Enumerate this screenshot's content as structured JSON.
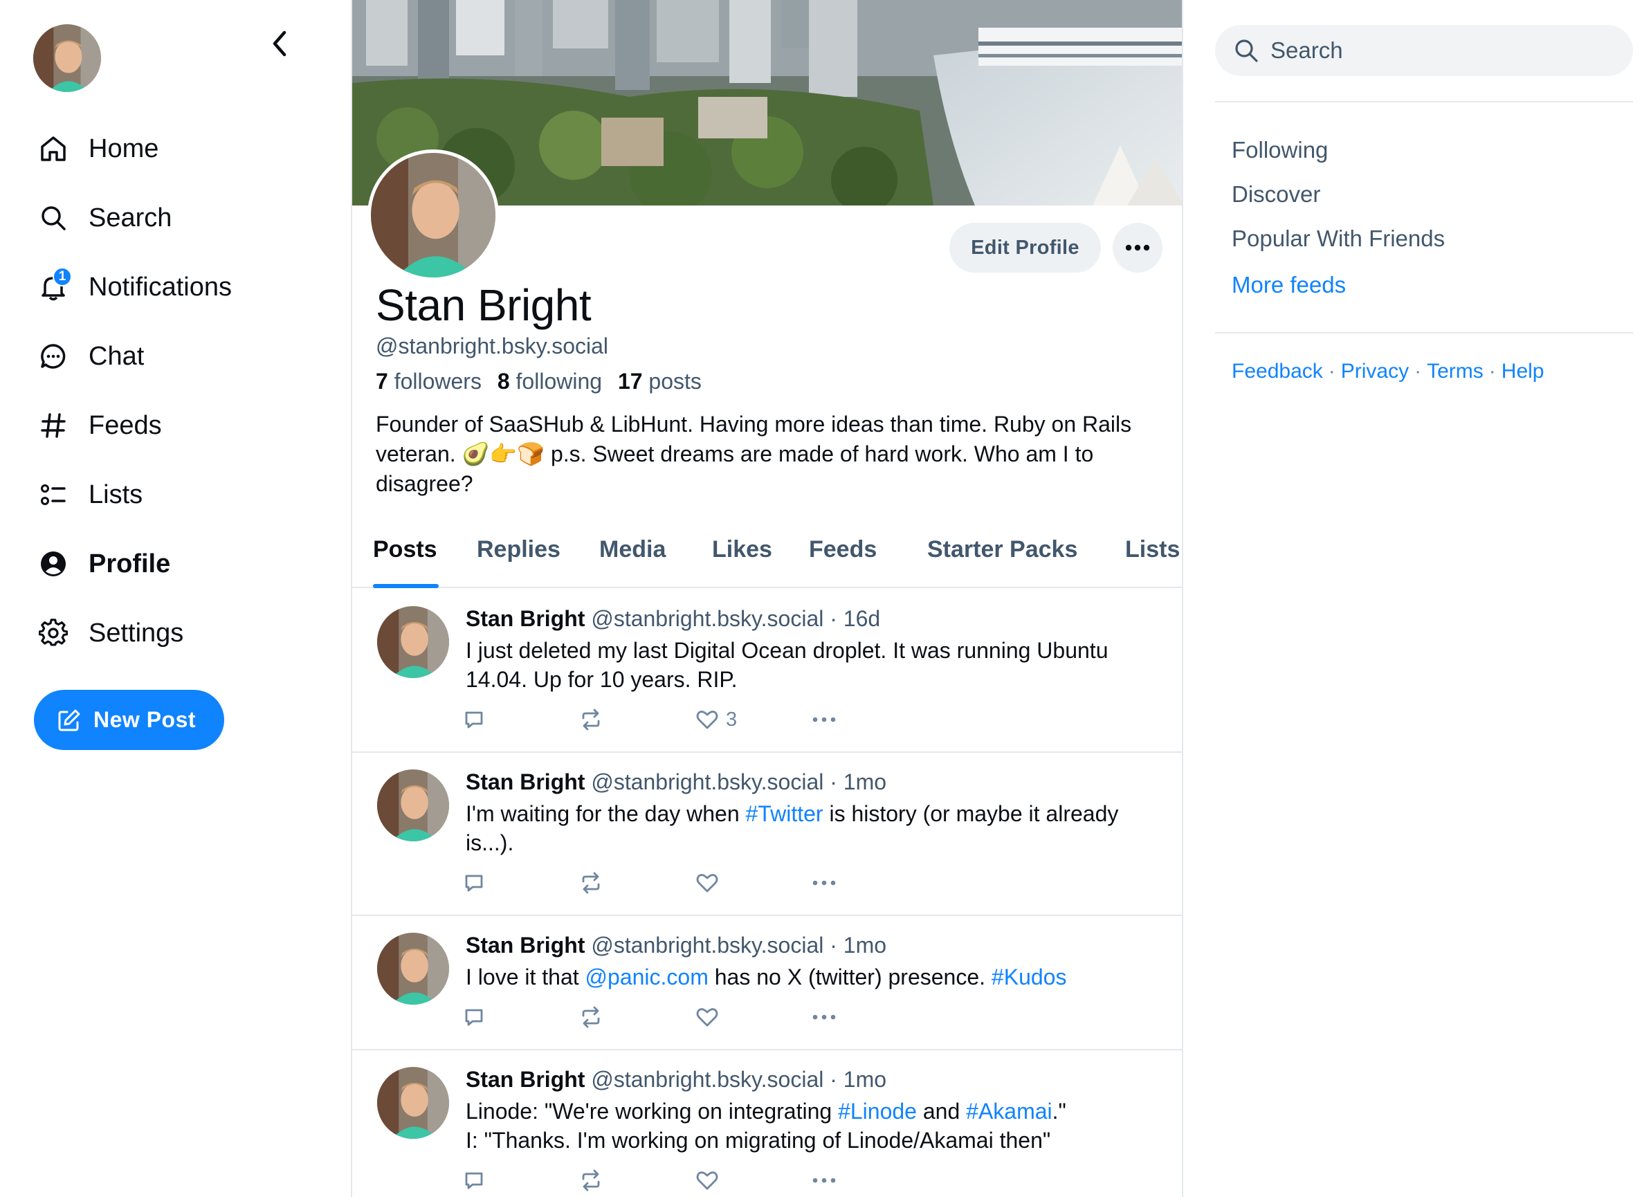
{
  "nav": {
    "items": [
      {
        "label": "Home",
        "icon": "home-icon"
      },
      {
        "label": "Search",
        "icon": "search-icon"
      },
      {
        "label": "Notifications",
        "icon": "bell-icon",
        "badge": "1"
      },
      {
        "label": "Chat",
        "icon": "chat-bubble-icon"
      },
      {
        "label": "Feeds",
        "icon": "hash-icon"
      },
      {
        "label": "Lists",
        "icon": "list-icon"
      },
      {
        "label": "Profile",
        "icon": "user-circle-icon",
        "active": true
      },
      {
        "label": "Settings",
        "icon": "gear-icon"
      }
    ],
    "new_post_label": "New Post"
  },
  "profile": {
    "name": "Stan Bright",
    "handle": "@stanbright.bsky.social",
    "followers_count": "7",
    "followers_label": "followers",
    "following_count": "8",
    "following_label": "following",
    "posts_count": "17",
    "posts_label": "posts",
    "bio_line1": "Founder of SaaSHub & LibHunt. Having more ideas than time. Ruby on Rails",
    "bio_line2_a": "veteran. 🥑👉🍞  p.s. Sweet dreams are made of hard work. Who am I to",
    "bio_line3": "disagree?",
    "edit_label": "Edit Profile"
  },
  "tabs": [
    "Posts",
    "Replies",
    "Media",
    "Likes",
    "Feeds",
    "Starter Packs",
    "Lists"
  ],
  "posts": [
    {
      "name": "Stan Bright",
      "handle": "@stanbright.bsky.social",
      "sep": "·",
      "time": "16d",
      "text_parts": [
        {
          "t": "I just deleted my last Digital Ocean droplet. It was running Ubuntu 14.04. Up for 10 years. RIP.",
          "link": false
        }
      ],
      "likes": "3"
    },
    {
      "name": "Stan Bright",
      "handle": "@stanbright.bsky.social",
      "sep": "·",
      "time": "1mo",
      "text_parts": [
        {
          "t": "I'm waiting for the day when ",
          "link": false
        },
        {
          "t": "#Twitter",
          "link": true
        },
        {
          "t": " is history (or maybe it already is...).",
          "link": false
        }
      ],
      "likes": ""
    },
    {
      "name": "Stan Bright",
      "handle": "@stanbright.bsky.social",
      "sep": "·",
      "time": "1mo",
      "text_parts": [
        {
          "t": "I love it that ",
          "link": false
        },
        {
          "t": "@panic.com",
          "link": true
        },
        {
          "t": " has no X (twitter) presence. ",
          "link": false
        },
        {
          "t": "#Kudos",
          "link": true
        }
      ],
      "likes": ""
    },
    {
      "name": "Stan Bright",
      "handle": "@stanbright.bsky.social",
      "sep": "·",
      "time": "1mo",
      "text_parts": [
        {
          "t": "Linode: \"We're working on integrating ",
          "link": false
        },
        {
          "t": "#Linode",
          "link": true
        },
        {
          "t": " and ",
          "link": false
        },
        {
          "t": "#Akamai",
          "link": true
        },
        {
          "t": ".\"",
          "link": false
        },
        {
          "t": "\n",
          "link": false
        },
        {
          "t": "I: \"Thanks. I'm working on migrating of Linode/Akamai then\"",
          "link": false
        }
      ],
      "likes": ""
    }
  ],
  "right": {
    "search_placeholder": "Search",
    "feeds": [
      "Following",
      "Discover",
      "Popular With Friends"
    ],
    "more_feeds": "More feeds",
    "footer": [
      "Feedback",
      "Privacy",
      "Terms",
      "Help"
    ],
    "footer_sep": "·"
  },
  "colors": {
    "accent": "#1083fe",
    "muted": "#42576c",
    "border": "#e4e8ec"
  }
}
